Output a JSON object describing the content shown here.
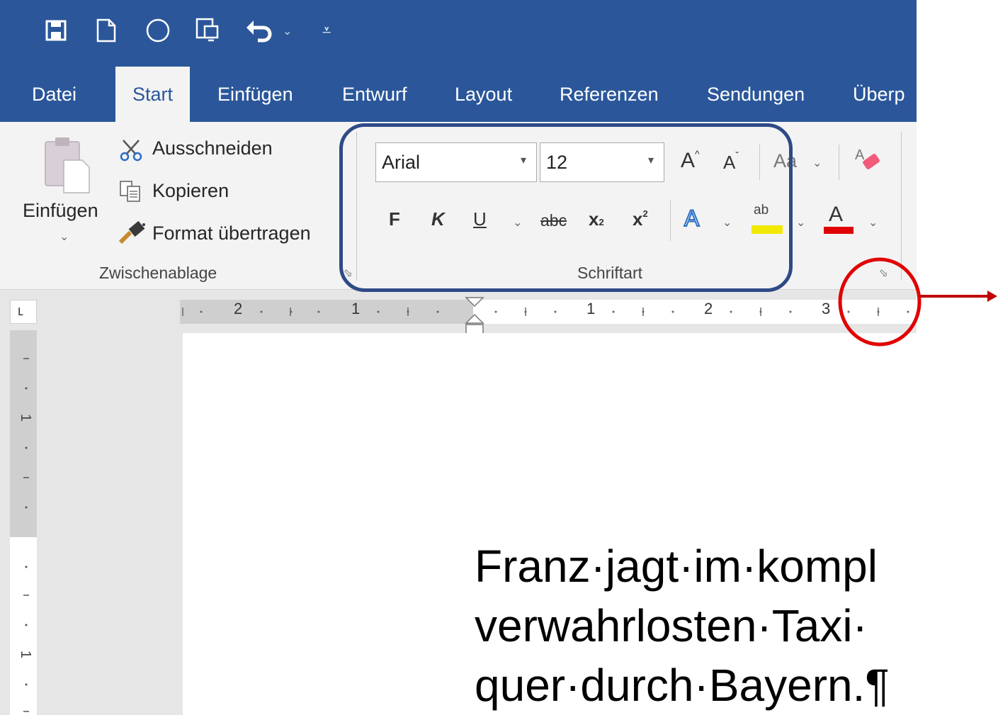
{
  "quick_access": {
    "icons": [
      "save-icon",
      "new-document-icon",
      "circle-icon",
      "touch-mode-icon",
      "undo-icon",
      "dropdown-icon",
      "customize-icon"
    ]
  },
  "tabs": [
    {
      "label": "Datei"
    },
    {
      "label": "Start",
      "active": true
    },
    {
      "label": "Einfügen"
    },
    {
      "label": "Entwurf"
    },
    {
      "label": "Layout"
    },
    {
      "label": "Referenzen"
    },
    {
      "label": "Sendungen"
    },
    {
      "label": "Überp"
    }
  ],
  "clipboard": {
    "paste_label": "Einfügen",
    "cut_label": "Ausschneiden",
    "copy_label": "Kopieren",
    "format_painter_label": "Format übertragen",
    "group_label": "Zwischenablage"
  },
  "font": {
    "family_value": "Arial",
    "size_value": "12",
    "grow_label": "A",
    "shrink_label": "A",
    "case_label": "Aa",
    "bold_label": "F",
    "italic_label": "K",
    "underline_label": "U",
    "strikethrough_label": "abc",
    "subscript_label": "x",
    "subscript_sub": "2",
    "superscript_label": "x",
    "superscript_sup": "2",
    "text_effects_label": "A",
    "highlight_label": "ab",
    "font_color_label": "A",
    "group_label": "Schriftart"
  },
  "ruler": {
    "numbers_left": [
      "2",
      "1"
    ],
    "numbers_right": [
      "1",
      "2",
      "3"
    ],
    "vertical_numbers": [
      "1",
      "1"
    ]
  },
  "document": {
    "lines": [
      "Franz·jagt·im·kompl",
      "verwahrlosten·Taxi·",
      "quer·durch·Bayern.¶"
    ]
  },
  "colors": {
    "ribbon_blue": "#2b579a",
    "annotation_box": "#2e4a86",
    "annotation_circle": "#e00000",
    "highlight_yellow": "#f2e900",
    "font_color_red": "#e00000"
  }
}
